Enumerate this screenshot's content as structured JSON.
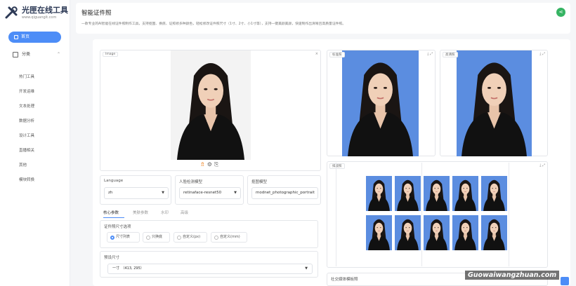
{
  "app": {
    "title": "光匣在线工具",
    "url": "www.qiguangit.com"
  },
  "sidebar": {
    "home_label": "首页",
    "category_label": "分类",
    "items": [
      "热门工具",
      "开发运维",
      "文本处理",
      "数据分析",
      "设计工具",
      "直播相关",
      "其他",
      "模块转换"
    ]
  },
  "header": {
    "title": "智能证件照",
    "description": "一款专业的AI智能在线证件照制作工具，支持抠图、换底、证照修多种颜色，轻松修改证件照尺寸（1寸、2寸、小1寸等），支持一键美颜美颜，快速制作出清晰且高质量证件照。"
  },
  "boxes": {
    "image_label": "Image",
    "standard_label": "标准照",
    "hd_label": "高清照",
    "layout_label": "排版照",
    "social_label": "社交媒体模板照"
  },
  "fields": {
    "language_label": "Language",
    "language_value": "zh",
    "face_model_label": "人脸检测模型",
    "face_model_value": "retinaface-resnet50",
    "matting_label": "抠图模型",
    "matting_value": "modnet_photographic_portrait"
  },
  "tabs": [
    "核心参数",
    "美肤参数",
    "水印",
    "高级"
  ],
  "size_section": {
    "label": "证件照尺寸选项",
    "options": [
      "尺寸列表",
      "只换底",
      "自定义(px)",
      "自定义(mm)"
    ],
    "selected": "尺寸列表"
  },
  "preset": {
    "label": "预设尺寸",
    "value": "一寸　（413, 295）"
  },
  "tools": [
    "⇯",
    "⚙",
    "⎘"
  ],
  "watermark": "Guowaiwangzhuan.com",
  "colors": {
    "accent": "#4d8df7",
    "photo_bg": "#5b8de0",
    "share": "#36b463"
  }
}
